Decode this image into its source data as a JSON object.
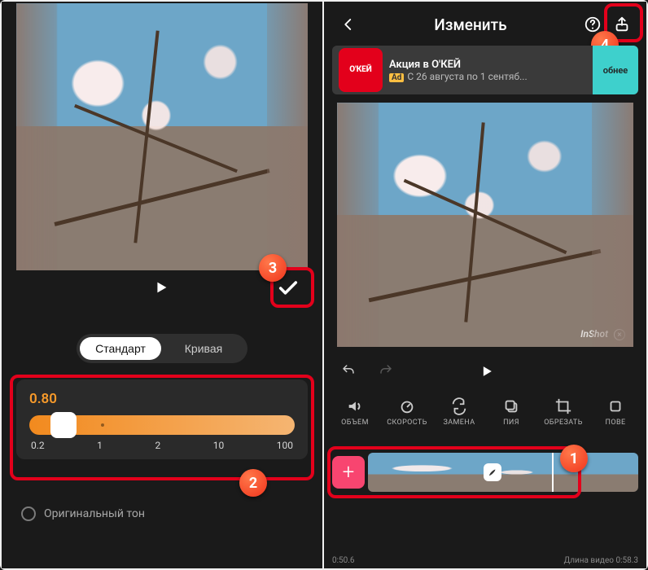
{
  "left": {
    "seg_tabs": {
      "standard": "Стандарт",
      "curve": "Кривая"
    },
    "speed": {
      "value": "0.80",
      "ticks": [
        "0.2",
        "1",
        "2",
        "10",
        "100"
      ]
    },
    "tone_label": "Оригинальный тон",
    "controls": {
      "play": "▶",
      "confirm": "✓"
    }
  },
  "right": {
    "title": "Изменить",
    "ad": {
      "logo": "О'КЕЙ",
      "headline": "Акция в О'КЕЙ",
      "subline": "С 26 августа по 1 сентяб...",
      "ad_label": "Ad",
      "cta": "обнее"
    },
    "watermark": "InShot",
    "tools": {
      "volume": "ОБЪЕМ",
      "speed": "СКОРОСТЬ",
      "replace": "ЗАМЕНА",
      "copy": "ПИЯ",
      "crop": "ОБРЕЗАТЬ",
      "rotate": "ПОВЕ"
    },
    "add": "+",
    "status": {
      "pos": "0:50.6",
      "len_label": "Длина видео",
      "len": "0:58.3"
    }
  },
  "steps": {
    "s1": "1",
    "s2": "2",
    "s3": "3",
    "s4": "4"
  }
}
